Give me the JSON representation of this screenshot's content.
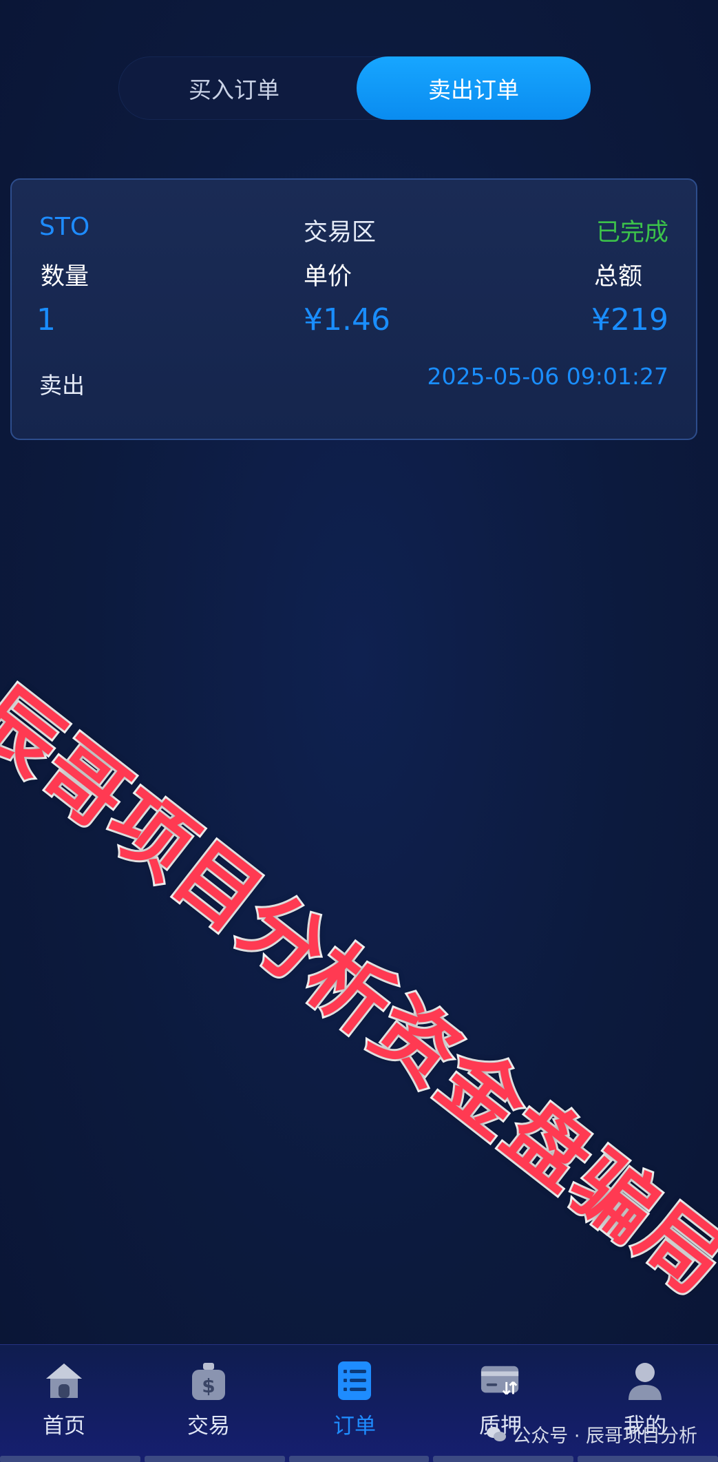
{
  "tabs": {
    "buy_label": "买入订单",
    "sell_label": "卖出订单",
    "active": "sell"
  },
  "order": {
    "pair": "STO",
    "zone": "交易区",
    "status": "已完成",
    "quantity_label": "数量",
    "price_label": "单价",
    "total_label": "总额",
    "quantity_value": "1",
    "price_value": "¥1.46",
    "total_value": "¥219",
    "side_label": "卖出",
    "timestamp": "2025-05-06 09:01:27"
  },
  "watermark": {
    "text": "辰哥项目分析资金盘骗局"
  },
  "nav": {
    "items": [
      {
        "label": "首页",
        "icon": "home-icon"
      },
      {
        "label": "交易",
        "icon": "money-bag-icon"
      },
      {
        "label": "订单",
        "icon": "order-list-icon"
      },
      {
        "label": "质押",
        "icon": "pledge-card-icon"
      },
      {
        "label": "我的",
        "icon": "user-icon"
      }
    ],
    "active_index": 2,
    "wechat_tag": "公众号 · 辰哥项目分析"
  },
  "colors": {
    "accent": "#1a8eff",
    "status_done": "#3cc24a",
    "watermark_red": "#ff3a52",
    "background": "#0c1a3d"
  }
}
